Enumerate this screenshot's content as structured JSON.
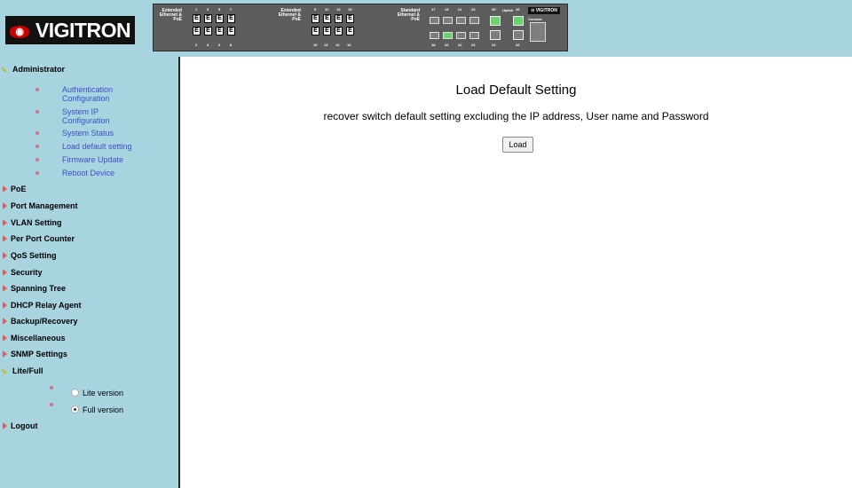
{
  "brand": {
    "name": "VIGITRON",
    "mini_logo": "VIGITRON"
  },
  "panel": {
    "group1_label": "Extended Ethernet & PoE",
    "group1_top_ports": [
      "1",
      "3",
      "5",
      "7"
    ],
    "group1_bottom_ports": [
      "2",
      "4",
      "6",
      "8"
    ],
    "group2_label": "Extended Ethernet & PoE",
    "group2_top_ports": [
      "9",
      "11",
      "13",
      "15"
    ],
    "group2_bottom_ports": [
      "10",
      "12",
      "14",
      "16"
    ],
    "group3_label": "Standard Ethernet & PoE",
    "group3_top_ports": [
      "17",
      "19",
      "21",
      "23"
    ],
    "group3_bottom_ports": [
      "18",
      "20",
      "22",
      "24"
    ],
    "uplink_label": "Uplink",
    "uplink_top": [
      "25",
      "26"
    ],
    "uplink_bottom": [
      "24",
      "26"
    ],
    "console_label": "Console",
    "port_glyph": "E"
  },
  "sidebar": {
    "administrator": "Administrator",
    "admin_items": [
      "Authentication Configuration",
      "System IP Configuration",
      "System Status",
      "Load default setting",
      "Firmware Update",
      "Reboot Device"
    ],
    "sections": [
      "PoE",
      "Port Management",
      "VLAN Setting",
      "Per Port Counter",
      "QoS Setting",
      "Security",
      "Spanning Tree",
      "DHCP Relay Agent",
      "Backup/Recovery",
      "Miscellaneous",
      "SNMP Settings"
    ],
    "lite_full": "Lite/Full",
    "lite_label": "Lite version",
    "full_label": "Full version",
    "selected_version": "Full version",
    "logout": "Logout"
  },
  "main": {
    "title": "Load Default Setting",
    "description": "recover switch default setting excluding the IP address, User name and Password",
    "load_button": "Load"
  },
  "colors": {
    "background_blue": "#a8d4e0",
    "link_blue": "#3a4fc9",
    "arrow_red": "#d86060",
    "uplink_green": "#6bd36b"
  }
}
